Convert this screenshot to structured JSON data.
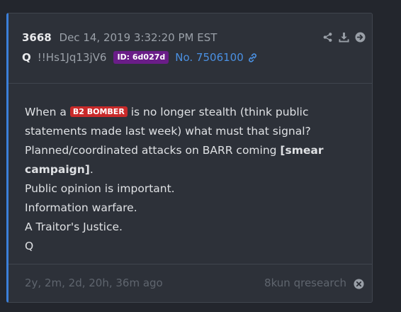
{
  "post": {
    "number": "3668",
    "timestamp": "Dec 14, 2019 3:32:20 PM EST",
    "author": "Q",
    "tripcode": "!!Hs1Jq13jV6",
    "id_badge": "ID: 6d027d",
    "post_link": "No. 7506100",
    "tag": "B2 BOMBER",
    "body": {
      "line1_pre": "When a",
      "line1_post": "is no longer stealth (think public statements made last week) what must that signal?",
      "line2_pre": "Planned/coordinated attacks on BARR coming ",
      "line2_bold": "[smear campaign]",
      "line2_post": ".",
      "line3": "Public opinion is important.",
      "line4": "Information warfare.",
      "line5": "A Traitor's Justice.",
      "line6": "Q"
    },
    "relative_time": "2y, 2m, 2d, 20h, 36m ago",
    "source": "8kun qresearch"
  },
  "icons": {
    "share": "share-icon",
    "download": "download-icon",
    "open": "arrow-right-circle-icon",
    "link": "link-icon",
    "close": "close-circle-icon"
  },
  "colors": {
    "accent": "#3b7fd9",
    "link": "#4a90e2",
    "id_badge": "#6a1d88",
    "tag": "#c92a2a"
  }
}
